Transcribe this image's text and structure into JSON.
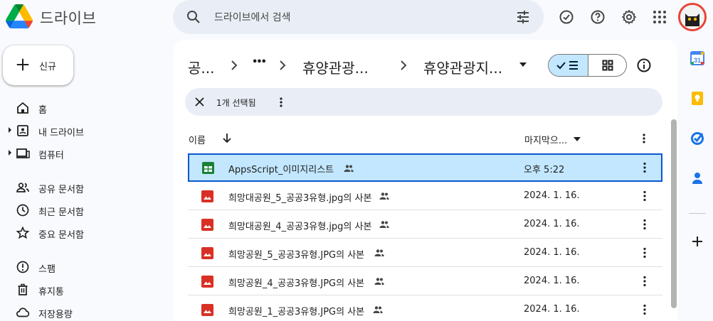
{
  "header": {
    "app_name": "드라이브",
    "search_placeholder": "드라이브에서 검색"
  },
  "sidebar": {
    "new_label": "신규",
    "items": [
      {
        "label": "홈"
      },
      {
        "label": "내 드라이브"
      },
      {
        "label": "컴퓨터"
      },
      {
        "label": "공유 문서함"
      },
      {
        "label": "최근 문서함"
      },
      {
        "label": "중요 문서함"
      },
      {
        "label": "스팸"
      },
      {
        "label": "휴지통"
      },
      {
        "label": "저장용량"
      }
    ]
  },
  "breadcrumb": {
    "root": "공...",
    "ellipsis": "•••",
    "middle": "휴양관광...",
    "current": "휴양관광지..."
  },
  "selection_bar": {
    "count_label": "1개 선택됨"
  },
  "columns": {
    "name": "이름",
    "modified": "마지막으..."
  },
  "files": [
    {
      "name": "AppsScript_이미지리스트",
      "date": "오후 5:22",
      "type": "sheets",
      "selected": true
    },
    {
      "name": "희망대공원_5_공공3유형.jpg의 사본",
      "date": "2024. 1. 16.",
      "type": "image",
      "selected": false
    },
    {
      "name": "희망대공원_4_공공3유형.jpg의 사본",
      "date": "2024. 1. 16.",
      "type": "image",
      "selected": false
    },
    {
      "name": "희망공원_5_공공3유형.JPG의 사본",
      "date": "2024. 1. 16.",
      "type": "image",
      "selected": false
    },
    {
      "name": "희망공원_4_공공3유형.JPG의 사본",
      "date": "2024. 1. 16.",
      "type": "image",
      "selected": false
    },
    {
      "name": "희망공원_1_공공3유형.JPG의 사본",
      "date": "2024. 1. 16.",
      "type": "image",
      "selected": false
    }
  ],
  "right_panel": {
    "calendar_label": "31"
  },
  "colors": {
    "accent": "#0b57d0",
    "selected_bg": "#c2e7ff",
    "image_icon": "#d93025",
    "sheets_icon": "#188038"
  }
}
